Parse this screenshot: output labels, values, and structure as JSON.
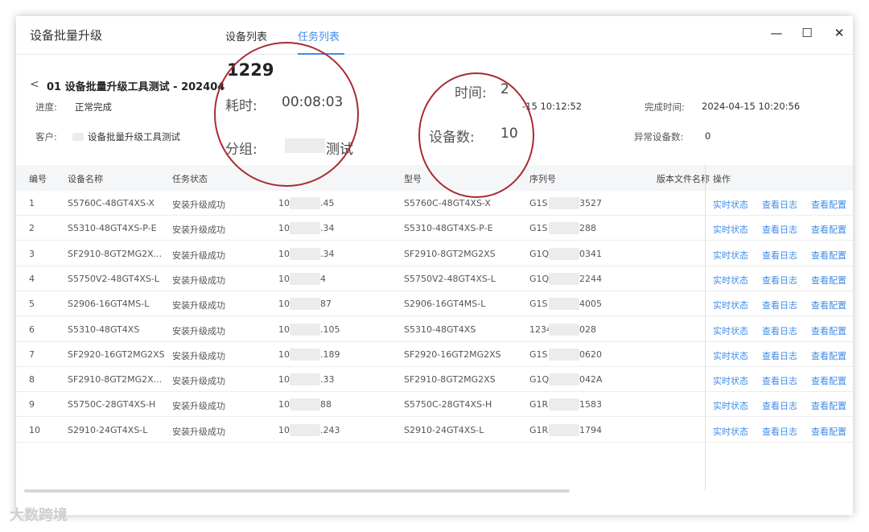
{
  "window": {
    "title": "设备批量升级",
    "minimize": "—",
    "maximize": "☐",
    "close": "✕"
  },
  "tabs": [
    {
      "label": "设备列表"
    },
    {
      "label": "任务列表"
    }
  ],
  "task": {
    "back": "<",
    "name": "01 设备批量升级工具测试 - 202404",
    "big_id": "1229",
    "progress_label": "进度:",
    "progress_value": "正常完成",
    "customer_label": "客户:",
    "customer_value": "设备批量升级工具测试",
    "duration_label": "耗时:",
    "duration_value": "00:08:03",
    "group_label": "分组:",
    "group_value": "测试",
    "start_label_partial": "时间:",
    "start_value_partial": "2",
    "start_time_small": "-15 10:12:52",
    "device_count_label": "设备数:",
    "device_count_value": "10",
    "finish_label": "完成时间:",
    "finish_value": "2024-04-15 10:20:56",
    "abnormal_label": "异常设备数:",
    "abnormal_value": "0"
  },
  "table": {
    "headers": [
      "编号",
      "设备名称",
      "任务状态",
      "型号",
      "序列号",
      "版本文件名称",
      "操作"
    ],
    "actions": [
      "实时状态",
      "查看日志",
      "查看配置"
    ],
    "rows": [
      {
        "no": "1",
        "name": "S5760C-48GT4XS-X",
        "status": "安装升级成功",
        "ip_prefix": "10.",
        "ip_suffix": ".45",
        "model": "S5760C-48GT4XS-X",
        "sn_prefix": "G1S",
        "sn_suffix": "3527"
      },
      {
        "no": "2",
        "name": "S5310-48GT4XS-P-E",
        "status": "安装升级成功",
        "ip_prefix": "10.",
        "ip_suffix": ".34",
        "model": "S5310-48GT4XS-P-E",
        "sn_prefix": "G1S",
        "sn_suffix": "288"
      },
      {
        "no": "3",
        "name": "SF2910-8GT2MG2X...",
        "status": "安装升级成功",
        "ip_prefix": "10.",
        "ip_suffix": ".34",
        "model": "SF2910-8GT2MG2XS",
        "sn_prefix": "G1Q",
        "sn_suffix": "0341"
      },
      {
        "no": "4",
        "name": "S5750V2-48GT4XS-L",
        "status": "安装升级成功",
        "ip_prefix": "10.",
        "ip_suffix": "4",
        "model": "S5750V2-48GT4XS-L",
        "sn_prefix": "G1Q",
        "sn_suffix": "2244"
      },
      {
        "no": "5",
        "name": "S2906-16GT4MS-L",
        "status": "安装升级成功",
        "ip_prefix": "10.",
        "ip_suffix": "87",
        "model": "S2906-16GT4MS-L",
        "sn_prefix": "G1S",
        "sn_suffix": "4005"
      },
      {
        "no": "6",
        "name": "S5310-48GT4XS",
        "status": "安装升级成功",
        "ip_prefix": "10.",
        "ip_suffix": ".105",
        "model": "S5310-48GT4XS",
        "sn_prefix": "1234",
        "sn_suffix": "028"
      },
      {
        "no": "7",
        "name": "SF2920-16GT2MG2XS",
        "status": "安装升级成功",
        "ip_prefix": "10.",
        "ip_suffix": ".189",
        "model": "SF2920-16GT2MG2XS",
        "sn_prefix": "G1S",
        "sn_suffix": "0620"
      },
      {
        "no": "8",
        "name": "SF2910-8GT2MG2X...",
        "status": "安装升级成功",
        "ip_prefix": "10.",
        "ip_suffix": ".33",
        "model": "SF2910-8GT2MG2XS",
        "sn_prefix": "G1Q",
        "sn_suffix": "042A"
      },
      {
        "no": "9",
        "name": "S5750C-28GT4XS-H",
        "status": "安装升级成功",
        "ip_prefix": "10.",
        "ip_suffix": "88",
        "model": "S5750C-28GT4XS-H",
        "sn_prefix": "G1R",
        "sn_suffix": "1583"
      },
      {
        "no": "10",
        "name": "S2910-24GT4XS-L",
        "status": "安装升级成功",
        "ip_prefix": "10.",
        "ip_suffix": ".243",
        "model": "S2910-24GT4XS-L",
        "sn_prefix": "G1R",
        "sn_suffix": "1794"
      }
    ]
  },
  "watermark": "大数跨境",
  "colors": {
    "accent": "#3f8ce8",
    "annotation_circle": "#a82b2f"
  }
}
